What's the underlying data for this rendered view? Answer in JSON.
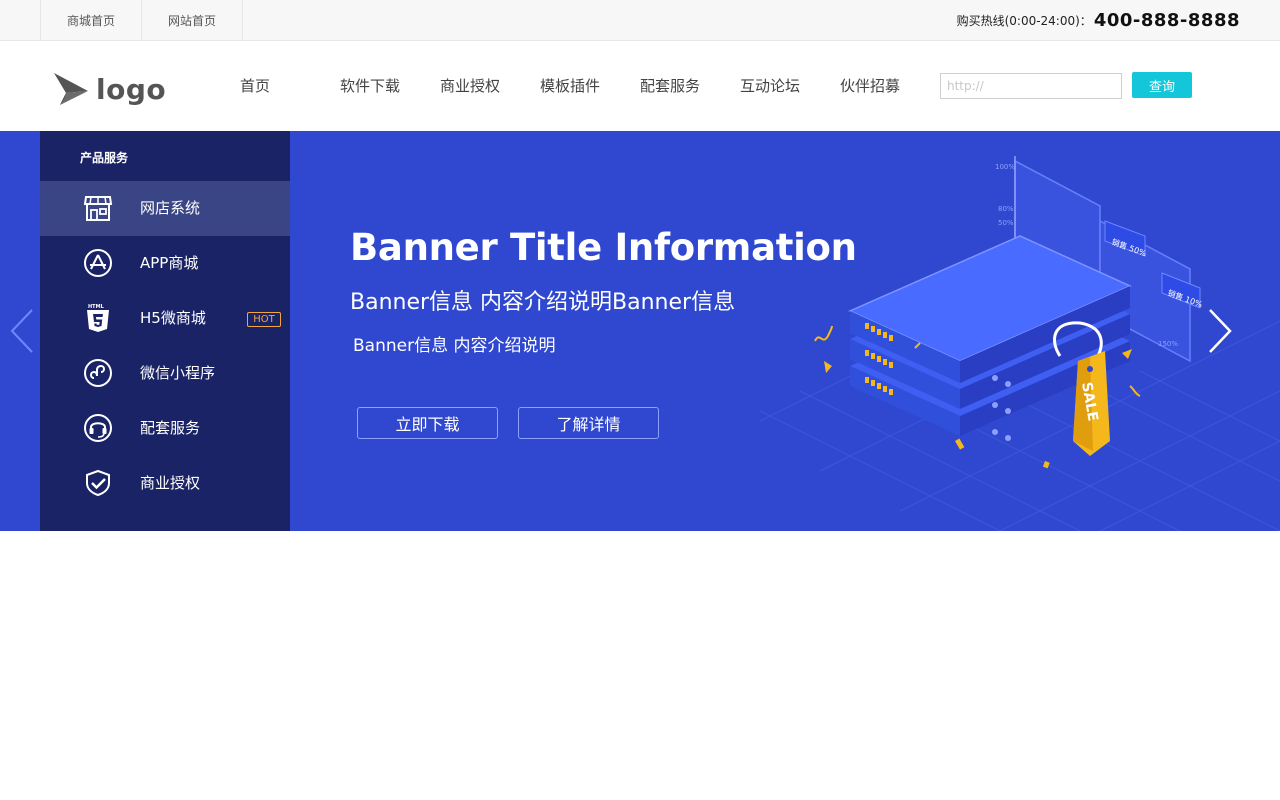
{
  "topbar": {
    "links": [
      "商城首页",
      "网站首页"
    ],
    "hotline_label": "购买热线(0:00-24:00)：",
    "hotline_number": "400-888-8888"
  },
  "header": {
    "logo_text": "logo",
    "nav": [
      "首页",
      "软件下载",
      "商业授权",
      "模板插件",
      "配套服务",
      "互动论坛",
      "伙伴招募"
    ],
    "search": {
      "placeholder": "http://",
      "value": ""
    },
    "search_button": "查询",
    "accent_color": "#14c6d9"
  },
  "sidebar": {
    "title": "产品服务",
    "items": [
      {
        "label": "网店系统",
        "icon": "store-icon",
        "active": true
      },
      {
        "label": "APP商城",
        "icon": "app-store-icon"
      },
      {
        "label": "H5微商城",
        "icon": "html5-icon",
        "badge": "HOT"
      },
      {
        "label": "微信小程序",
        "icon": "mini-program-icon"
      },
      {
        "label": "配套服务",
        "icon": "headset-icon"
      },
      {
        "label": "商业授权",
        "icon": "shield-check-icon"
      }
    ],
    "background": "#1a2366"
  },
  "banner": {
    "title": "Banner Title Information",
    "subtitle": "Banner信息 内容介绍说明Banner信息",
    "subtitle2": "Banner信息 内容介绍说明",
    "buttons": [
      "立即下载",
      "了解详情"
    ],
    "background": "#3048cf",
    "illustration_text": {
      "tag": "SALE",
      "axis": [
        "100%",
        "80%",
        "50%",
        "150%"
      ],
      "flag1": "销售 50%",
      "flag2": "销售 10%"
    }
  }
}
